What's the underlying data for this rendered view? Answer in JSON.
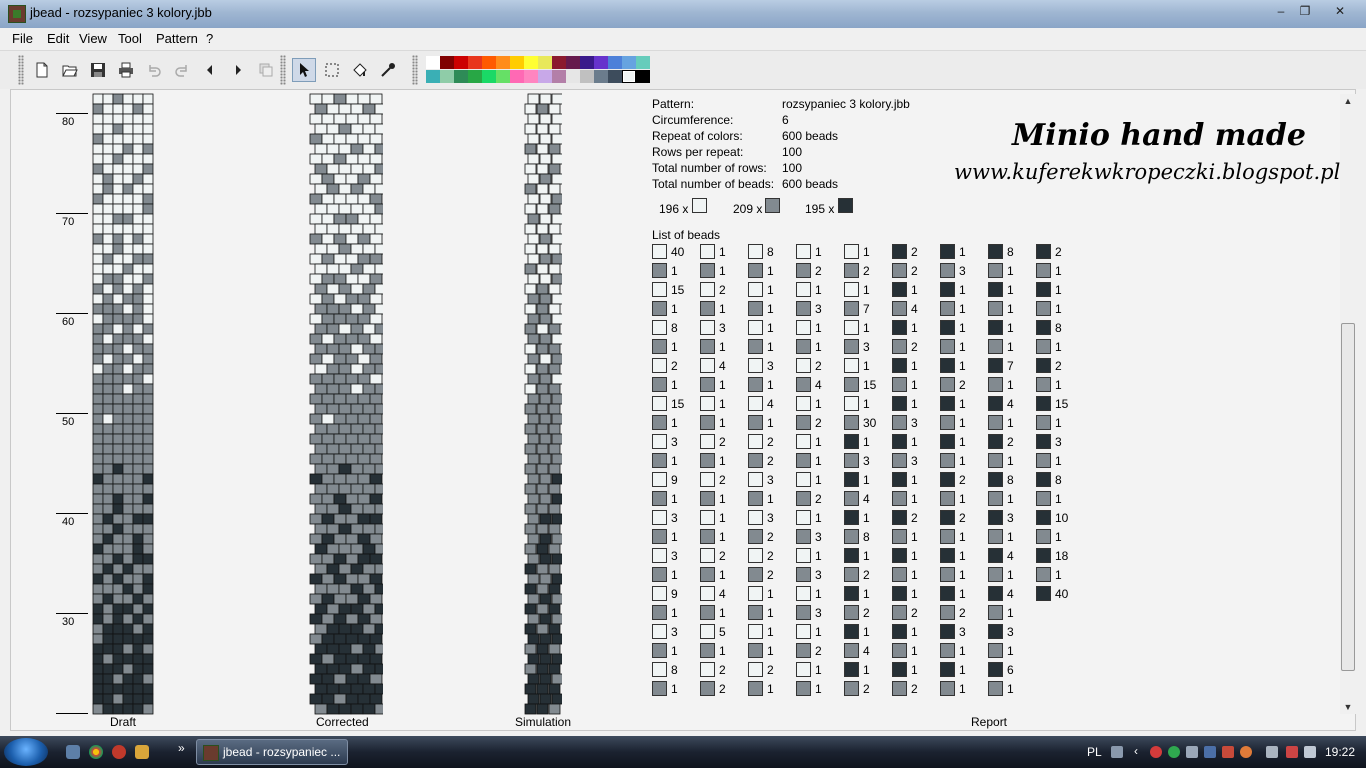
{
  "window": {
    "title": "jbead - rozsypaniec 3 kolory.jbb"
  },
  "menu": [
    "File",
    "Edit",
    "View",
    "Tool",
    "Pattern",
    "?"
  ],
  "toolbar_icons": [
    "new-file-icon",
    "open-folder-icon",
    "save-icon",
    "print-icon",
    "undo-icon",
    "redo-icon",
    "arrow-left-icon",
    "arrow-right-icon",
    "copy-icon",
    "pointer-icon",
    "select-rectangle-icon",
    "fill-bucket-icon",
    "eyedropper-icon"
  ],
  "palette": [
    "#ffffff",
    "#800000",
    "#cc0000",
    "#e8361c",
    "#ff5a00",
    "#ff8c1a",
    "#ffcc00",
    "#ffff33",
    "#e8e85a",
    "#8b1a2e",
    "#661a4d",
    "#3a1a8b",
    "#6633cc",
    "#4d80d9",
    "#66a3e0",
    "#66ccbb",
    "#3aafb5",
    "#8fcca8",
    "#2e8b57",
    "#28a745",
    "#1ad966",
    "#66e066",
    "#ff69b4",
    "#ff85c0",
    "#c8a8e8",
    "#b37fa8",
    "#e6e6e6",
    "#c0c0c0",
    "#6b7c8c",
    "#3d4c5c",
    "#f0f4f4",
    "#000000"
  ],
  "palette_selected": 30,
  "colors": {
    "light": "#f0f4f4",
    "mid": "#828a90",
    "dark": "#263036"
  },
  "ruler_numbers": [
    "80",
    "70",
    "60",
    "50",
    "40",
    "30"
  ],
  "panels": {
    "draft": "Draft",
    "corrected": "Corrected",
    "simulation": "Simulation",
    "report": "Report"
  },
  "report": {
    "fields": [
      {
        "label": "Pattern:",
        "value": "rozsypaniec 3 kolory.jbb"
      },
      {
        "label": "Circumference:",
        "value": "6"
      },
      {
        "label": "Repeat of colors:",
        "value": "600 beads"
      },
      {
        "label": "Rows per repeat:",
        "value": "100"
      },
      {
        "label": "Total number of rows:",
        "value": "100"
      },
      {
        "label": "Total number of beads:",
        "value": "600 beads"
      }
    ],
    "summary": [
      {
        "count": "196 x",
        "color": "light"
      },
      {
        "count": "209 x",
        "color": "mid"
      },
      {
        "count": "195 x",
        "color": "dark"
      }
    ],
    "list_title": "List of beads",
    "bead_columns": [
      [
        [
          "L",
          "40"
        ],
        [
          "M",
          "1"
        ],
        [
          "L",
          "15"
        ],
        [
          "M",
          "1"
        ],
        [
          "L",
          "8"
        ],
        [
          "M",
          "1"
        ],
        [
          "L",
          "2"
        ],
        [
          "M",
          "1"
        ],
        [
          "L",
          "15"
        ],
        [
          "M",
          "1"
        ],
        [
          "L",
          "3"
        ],
        [
          "M",
          "1"
        ],
        [
          "L",
          "9"
        ],
        [
          "M",
          "1"
        ],
        [
          "L",
          "3"
        ],
        [
          "M",
          "1"
        ],
        [
          "L",
          "3"
        ],
        [
          "M",
          "1"
        ],
        [
          "L",
          "9"
        ],
        [
          "M",
          "1"
        ],
        [
          "L",
          "3"
        ],
        [
          "M",
          "1"
        ],
        [
          "L",
          "8"
        ],
        [
          "M",
          "1"
        ]
      ],
      [
        [
          "L",
          "1"
        ],
        [
          "M",
          "1"
        ],
        [
          "L",
          "2"
        ],
        [
          "M",
          "1"
        ],
        [
          "L",
          "3"
        ],
        [
          "M",
          "1"
        ],
        [
          "L",
          "4"
        ],
        [
          "M",
          "1"
        ],
        [
          "L",
          "1"
        ],
        [
          "M",
          "1"
        ],
        [
          "L",
          "2"
        ],
        [
          "M",
          "1"
        ],
        [
          "L",
          "2"
        ],
        [
          "M",
          "1"
        ],
        [
          "L",
          "1"
        ],
        [
          "M",
          "1"
        ],
        [
          "L",
          "2"
        ],
        [
          "M",
          "1"
        ],
        [
          "L",
          "4"
        ],
        [
          "M",
          "1"
        ],
        [
          "L",
          "5"
        ],
        [
          "M",
          "1"
        ],
        [
          "L",
          "2"
        ],
        [
          "M",
          "2"
        ]
      ],
      [
        [
          "L",
          "8"
        ],
        [
          "M",
          "1"
        ],
        [
          "L",
          "1"
        ],
        [
          "M",
          "1"
        ],
        [
          "L",
          "1"
        ],
        [
          "M",
          "1"
        ],
        [
          "L",
          "3"
        ],
        [
          "M",
          "1"
        ],
        [
          "L",
          "4"
        ],
        [
          "M",
          "1"
        ],
        [
          "L",
          "2"
        ],
        [
          "M",
          "2"
        ],
        [
          "L",
          "3"
        ],
        [
          "M",
          "1"
        ],
        [
          "L",
          "3"
        ],
        [
          "M",
          "2"
        ],
        [
          "L",
          "2"
        ],
        [
          "M",
          "2"
        ],
        [
          "L",
          "1"
        ],
        [
          "M",
          "1"
        ],
        [
          "L",
          "1"
        ],
        [
          "M",
          "1"
        ],
        [
          "L",
          "2"
        ],
        [
          "M",
          "1"
        ]
      ],
      [
        [
          "L",
          "1"
        ],
        [
          "M",
          "2"
        ],
        [
          "L",
          "1"
        ],
        [
          "M",
          "3"
        ],
        [
          "L",
          "1"
        ],
        [
          "M",
          "1"
        ],
        [
          "L",
          "2"
        ],
        [
          "M",
          "4"
        ],
        [
          "L",
          "1"
        ],
        [
          "M",
          "2"
        ],
        [
          "L",
          "1"
        ],
        [
          "M",
          "1"
        ],
        [
          "L",
          "1"
        ],
        [
          "M",
          "2"
        ],
        [
          "L",
          "1"
        ],
        [
          "M",
          "3"
        ],
        [
          "L",
          "1"
        ],
        [
          "M",
          "3"
        ],
        [
          "L",
          "1"
        ],
        [
          "M",
          "3"
        ],
        [
          "L",
          "1"
        ],
        [
          "M",
          "2"
        ],
        [
          "L",
          "1"
        ],
        [
          "M",
          "1"
        ]
      ],
      [
        [
          "L",
          "1"
        ],
        [
          "M",
          "2"
        ],
        [
          "L",
          "1"
        ],
        [
          "M",
          "7"
        ],
        [
          "L",
          "1"
        ],
        [
          "M",
          "3"
        ],
        [
          "L",
          "1"
        ],
        [
          "M",
          "15"
        ],
        [
          "L",
          "1"
        ],
        [
          "M",
          "30"
        ],
        [
          "D",
          "1"
        ],
        [
          "M",
          "3"
        ],
        [
          "D",
          "1"
        ],
        [
          "M",
          "4"
        ],
        [
          "D",
          "1"
        ],
        [
          "M",
          "8"
        ],
        [
          "D",
          "1"
        ],
        [
          "M",
          "2"
        ],
        [
          "D",
          "1"
        ],
        [
          "M",
          "2"
        ],
        [
          "D",
          "1"
        ],
        [
          "M",
          "4"
        ],
        [
          "D",
          "1"
        ],
        [
          "M",
          "2"
        ]
      ],
      [
        [
          "D",
          "2"
        ],
        [
          "M",
          "2"
        ],
        [
          "D",
          "1"
        ],
        [
          "M",
          "4"
        ],
        [
          "D",
          "1"
        ],
        [
          "M",
          "2"
        ],
        [
          "D",
          "1"
        ],
        [
          "M",
          "1"
        ],
        [
          "D",
          "1"
        ],
        [
          "M",
          "3"
        ],
        [
          "D",
          "1"
        ],
        [
          "M",
          "3"
        ],
        [
          "D",
          "1"
        ],
        [
          "M",
          "1"
        ],
        [
          "D",
          "2"
        ],
        [
          "M",
          "1"
        ],
        [
          "D",
          "1"
        ],
        [
          "M",
          "1"
        ],
        [
          "D",
          "1"
        ],
        [
          "M",
          "2"
        ],
        [
          "D",
          "1"
        ],
        [
          "M",
          "1"
        ],
        [
          "D",
          "1"
        ],
        [
          "M",
          "2"
        ]
      ],
      [
        [
          "D",
          "1"
        ],
        [
          "M",
          "3"
        ],
        [
          "D",
          "1"
        ],
        [
          "M",
          "1"
        ],
        [
          "D",
          "1"
        ],
        [
          "M",
          "1"
        ],
        [
          "D",
          "1"
        ],
        [
          "M",
          "2"
        ],
        [
          "D",
          "1"
        ],
        [
          "M",
          "1"
        ],
        [
          "D",
          "1"
        ],
        [
          "M",
          "1"
        ],
        [
          "D",
          "2"
        ],
        [
          "M",
          "1"
        ],
        [
          "D",
          "2"
        ],
        [
          "M",
          "1"
        ],
        [
          "D",
          "1"
        ],
        [
          "M",
          "1"
        ],
        [
          "D",
          "1"
        ],
        [
          "M",
          "2"
        ],
        [
          "D",
          "3"
        ],
        [
          "M",
          "1"
        ],
        [
          "D",
          "1"
        ],
        [
          "M",
          "1"
        ]
      ],
      [
        [
          "D",
          "8"
        ],
        [
          "M",
          "1"
        ],
        [
          "D",
          "1"
        ],
        [
          "M",
          "1"
        ],
        [
          "D",
          "1"
        ],
        [
          "M",
          "1"
        ],
        [
          "D",
          "7"
        ],
        [
          "M",
          "1"
        ],
        [
          "D",
          "4"
        ],
        [
          "M",
          "1"
        ],
        [
          "D",
          "2"
        ],
        [
          "M",
          "1"
        ],
        [
          "D",
          "8"
        ],
        [
          "M",
          "1"
        ],
        [
          "D",
          "3"
        ],
        [
          "M",
          "1"
        ],
        [
          "D",
          "4"
        ],
        [
          "M",
          "1"
        ],
        [
          "D",
          "4"
        ],
        [
          "M",
          "1"
        ],
        [
          "D",
          "3"
        ],
        [
          "M",
          "1"
        ],
        [
          "D",
          "6"
        ],
        [
          "M",
          "1"
        ]
      ],
      [
        [
          "D",
          "2"
        ],
        [
          "M",
          "1"
        ],
        [
          "D",
          "1"
        ],
        [
          "M",
          "1"
        ],
        [
          "D",
          "8"
        ],
        [
          "M",
          "1"
        ],
        [
          "D",
          "2"
        ],
        [
          "M",
          "1"
        ],
        [
          "D",
          "15"
        ],
        [
          "M",
          "1"
        ],
        [
          "D",
          "3"
        ],
        [
          "M",
          "1"
        ],
        [
          "D",
          "8"
        ],
        [
          "M",
          "1"
        ],
        [
          "D",
          "10"
        ],
        [
          "M",
          "1"
        ],
        [
          "D",
          "18"
        ],
        [
          "M",
          "1"
        ],
        [
          "D",
          "40"
        ]
      ]
    ]
  },
  "branding": {
    "line1": "Minio hand made",
    "line2": "www.kuferekwkropeczki.blogspot.pl"
  },
  "taskbar": {
    "task_title": "jbead - rozsypaniec ...",
    "language": "PL",
    "clock": "19:22"
  }
}
